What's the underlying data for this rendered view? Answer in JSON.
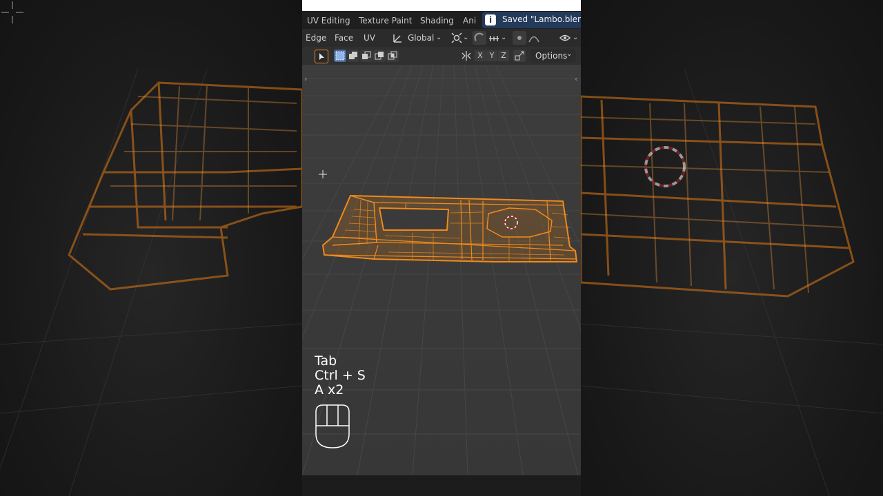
{
  "workspace_tabs": [
    "UV Editing",
    "Texture Paint",
    "Shading",
    "Ani"
  ],
  "notification": {
    "text": "Saved \"Lambo.blend\"",
    "icon": "info-icon"
  },
  "header": {
    "menus": [
      "Edge",
      "Face",
      "UV"
    ],
    "transform_orientation": "Global",
    "pivot_icon": "pivot-icon",
    "snap_icon": "magnet-icon"
  },
  "tool_row": {
    "axes": [
      "X",
      "Y",
      "Z"
    ],
    "options_label": "Options"
  },
  "keystrokes": [
    "Tab",
    "Ctrl + S",
    "A x2"
  ],
  "colors": {
    "accent_orange": "#f08a1c",
    "viewport_bg": "#3a3a3a",
    "grid": "#4a4a4a",
    "notification_bg": "#243a5a"
  }
}
